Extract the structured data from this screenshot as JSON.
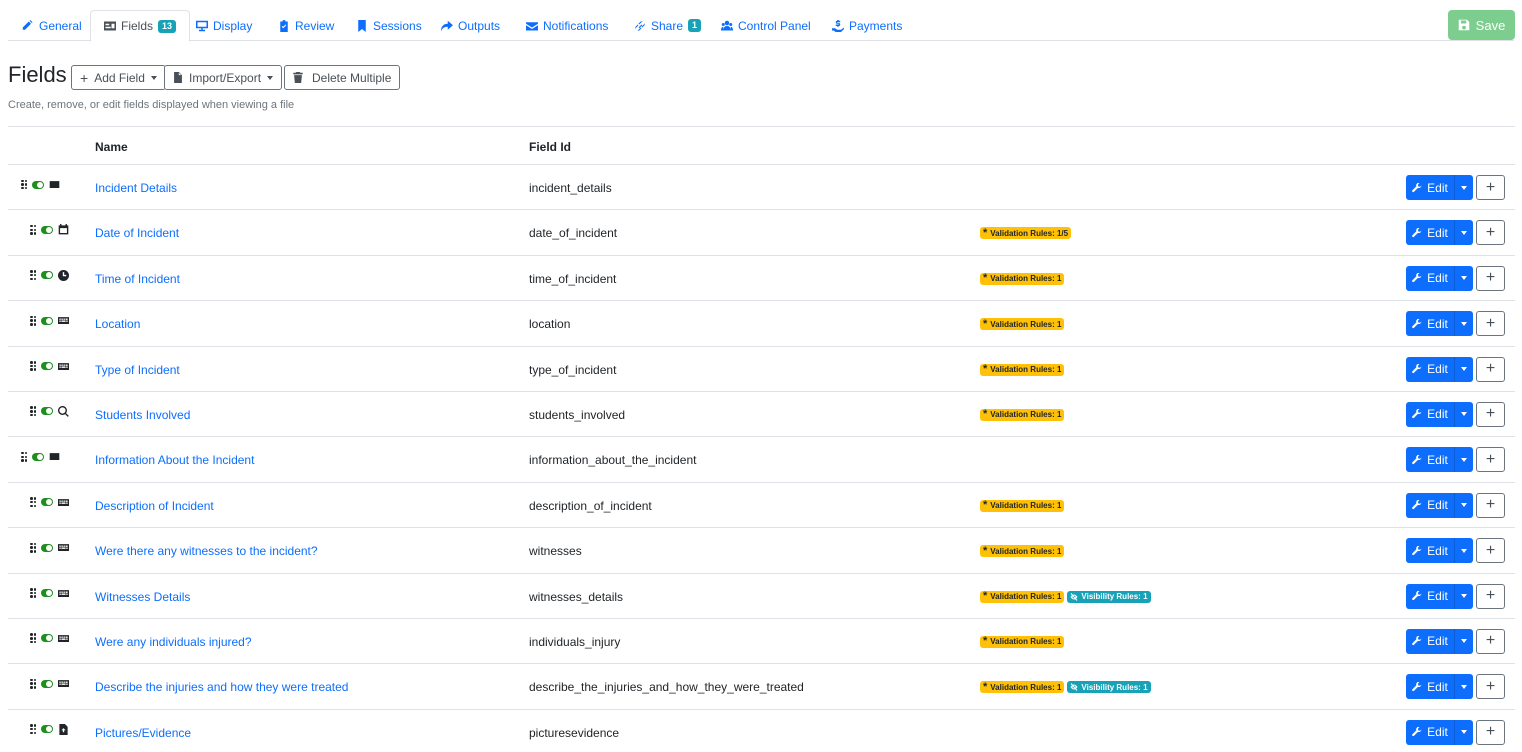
{
  "tabs": [
    {
      "label": "General",
      "icon": "edit-icon"
    },
    {
      "label": "Fields",
      "icon": "id-card-icon",
      "badge": "13",
      "active": true
    },
    {
      "label": "Display",
      "icon": "desktop-icon"
    },
    {
      "label": "Review",
      "icon": "clipboard-check-icon"
    },
    {
      "label": "Sessions",
      "icon": "bookmark-icon"
    },
    {
      "label": "Outputs",
      "icon": "share-arrow-icon"
    },
    {
      "label": "Notifications",
      "icon": "envelope-icon"
    },
    {
      "label": "Share",
      "icon": "link-icon",
      "badge": "1"
    },
    {
      "label": "Control Panel",
      "icon": "users-icon"
    },
    {
      "label": "Payments",
      "icon": "hand-holding-dollar-icon"
    }
  ],
  "save_label": "Save",
  "header": {
    "title": "Fields",
    "add_field": "Add Field",
    "import_export": "Import/Export",
    "delete_multiple": "Delete Multiple",
    "subtitle": "Create, remove, or edit fields displayed when viewing a file"
  },
  "table": {
    "col_name": "Name",
    "col_field_id": "Field Id",
    "edit_label": "Edit",
    "rows": [
      {
        "name": "Incident Details",
        "id": "incident_details",
        "icon": "section-icon",
        "indent": 0,
        "validation": "",
        "visibility": ""
      },
      {
        "name": "Date of Incident",
        "id": "date_of_incident",
        "icon": "calendar-icon",
        "indent": 1,
        "validation": "Validation Rules: 1/5",
        "visibility": ""
      },
      {
        "name": "Time of Incident",
        "id": "time_of_incident",
        "icon": "clock-icon",
        "indent": 1,
        "validation": "Validation Rules: 1",
        "visibility": ""
      },
      {
        "name": "Location",
        "id": "location",
        "icon": "keyboard-icon",
        "indent": 1,
        "validation": "Validation Rules: 1",
        "visibility": ""
      },
      {
        "name": "Type of Incident",
        "id": "type_of_incident",
        "icon": "keyboard-icon",
        "indent": 1,
        "validation": "Validation Rules: 1",
        "visibility": ""
      },
      {
        "name": "Students Involved",
        "id": "students_involved",
        "icon": "search-icon",
        "indent": 1,
        "validation": "Validation Rules: 1",
        "visibility": ""
      },
      {
        "name": "Information About the Incident",
        "id": "information_about_the_incident",
        "icon": "section-icon",
        "indent": 0,
        "validation": "",
        "visibility": ""
      },
      {
        "name": "Description of Incident",
        "id": "description_of_incident",
        "icon": "keyboard-icon",
        "indent": 1,
        "validation": "Validation Rules: 1",
        "visibility": ""
      },
      {
        "name": "Were there any witnesses to the incident?",
        "id": "witnesses",
        "icon": "keyboard-icon",
        "indent": 1,
        "validation": "Validation Rules: 1",
        "visibility": ""
      },
      {
        "name": "Witnesses Details",
        "id": "witnesses_details",
        "icon": "keyboard-icon",
        "indent": 1,
        "validation": "Validation Rules: 1",
        "visibility": "Visibility Rules: 1"
      },
      {
        "name": "Were any individuals injured?",
        "id": "individuals_injury",
        "icon": "keyboard-icon",
        "indent": 1,
        "validation": "Validation Rules: 1",
        "visibility": ""
      },
      {
        "name": "Describe the injuries and how they were treated",
        "id": "describe_the_injuries_and_how_they_were_treated",
        "icon": "keyboard-icon",
        "indent": 1,
        "validation": "Validation Rules: 1",
        "visibility": "Visibility Rules: 1"
      },
      {
        "name": "Pictures/Evidence",
        "id": "picturesevidence",
        "icon": "file-upload-icon",
        "indent": 1,
        "validation": "",
        "visibility": ""
      }
    ]
  }
}
